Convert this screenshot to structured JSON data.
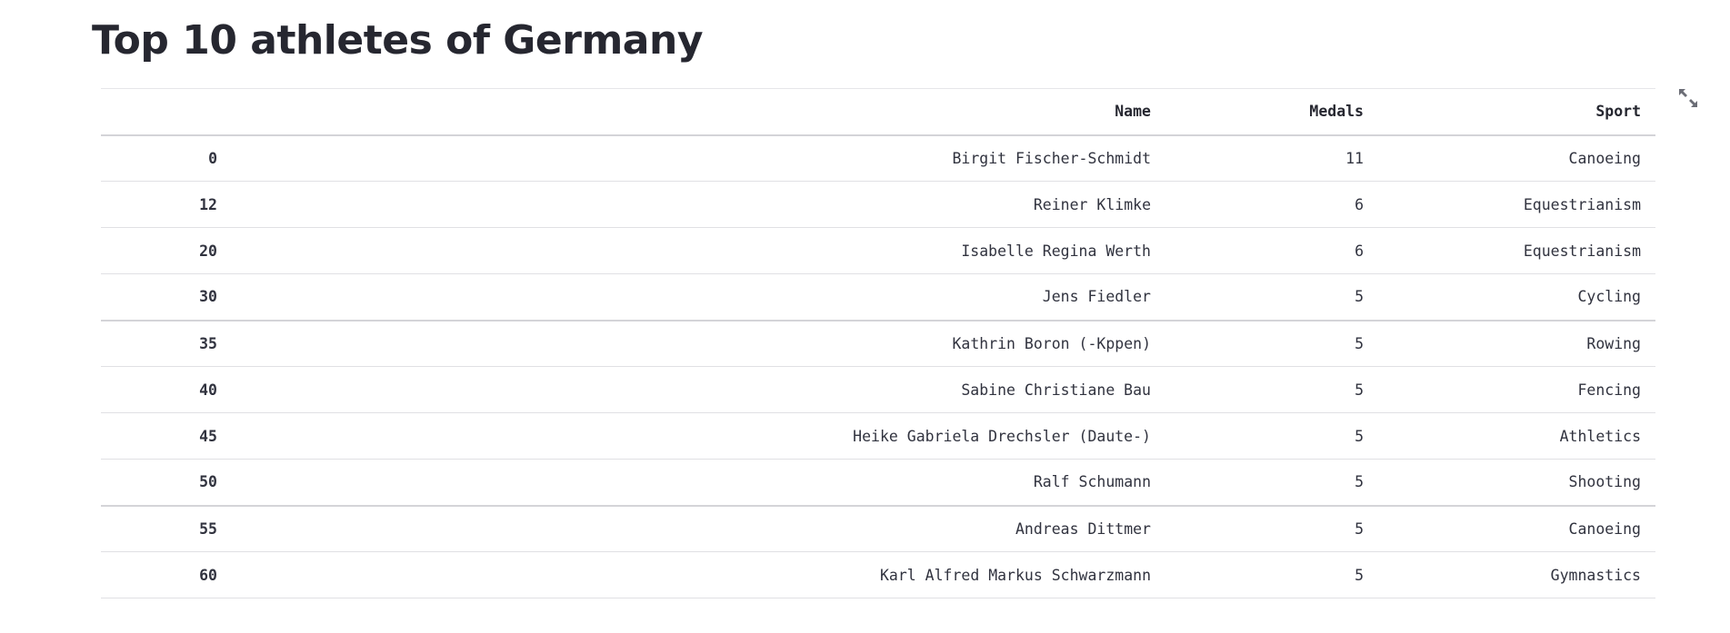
{
  "page": {
    "title": "Top 10 athletes of Germany"
  },
  "toolbar": {
    "expand_icon": "fullscreen-expand-icon"
  },
  "table": {
    "columns": [
      "",
      "Name",
      "Medals",
      "Sport"
    ],
    "rows": [
      {
        "index": "0",
        "name": "Birgit Fischer-Schmidt",
        "medals": "11",
        "sport": "Canoeing"
      },
      {
        "index": "12",
        "name": "Reiner Klimke",
        "medals": "6",
        "sport": "Equestrianism"
      },
      {
        "index": "20",
        "name": "Isabelle Regina Werth",
        "medals": "6",
        "sport": "Equestrianism"
      },
      {
        "index": "30",
        "name": "Jens Fiedler",
        "medals": "5",
        "sport": "Cycling"
      },
      {
        "index": "35",
        "name": "Kathrin Boron (-Kppen)",
        "medals": "5",
        "sport": "Rowing"
      },
      {
        "index": "40",
        "name": "Sabine Christiane Bau",
        "medals": "5",
        "sport": "Fencing"
      },
      {
        "index": "45",
        "name": "Heike Gabriela Drechsler (Daute-)",
        "medals": "5",
        "sport": "Athletics"
      },
      {
        "index": "50",
        "name": "Ralf Schumann",
        "medals": "5",
        "sport": "Shooting"
      },
      {
        "index": "55",
        "name": "Andreas Dittmer",
        "medals": "5",
        "sport": "Canoeing"
      },
      {
        "index": "60",
        "name": "Karl Alfred Markus Schwarzmann",
        "medals": "5",
        "sport": "Gymnastics"
      }
    ]
  }
}
